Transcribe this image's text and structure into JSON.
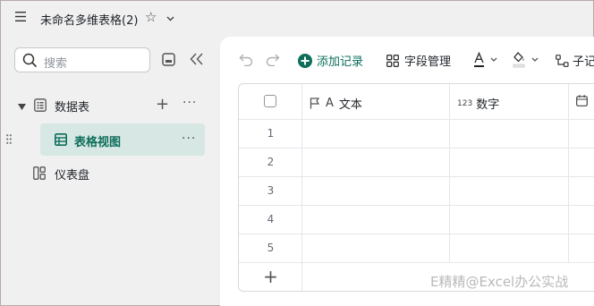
{
  "app": {
    "title": "未命名多维表格(2)"
  },
  "sidebar": {
    "search_placeholder": "搜索",
    "tree": {
      "database_label": "数据表",
      "view_label": "表格视图",
      "dashboard_label": "仪表盘",
      "more": "···",
      "add": "+"
    }
  },
  "toolbar": {
    "add_record": "添加记录",
    "field_manage": "字段管理",
    "sub": "子记"
  },
  "grid": {
    "columns": [
      {
        "label": "文本",
        "type_glyph": "A"
      },
      {
        "label": "数字",
        "type_glyph": "123"
      }
    ],
    "rows": [
      "1",
      "2",
      "3",
      "4",
      "5"
    ],
    "add_row": "+"
  },
  "watermark": "E精精@Excel办公实战",
  "colors": {
    "accent": "#0d6e5a",
    "selected_bg": "#d7e7e3",
    "background": "#f0f0f0"
  }
}
